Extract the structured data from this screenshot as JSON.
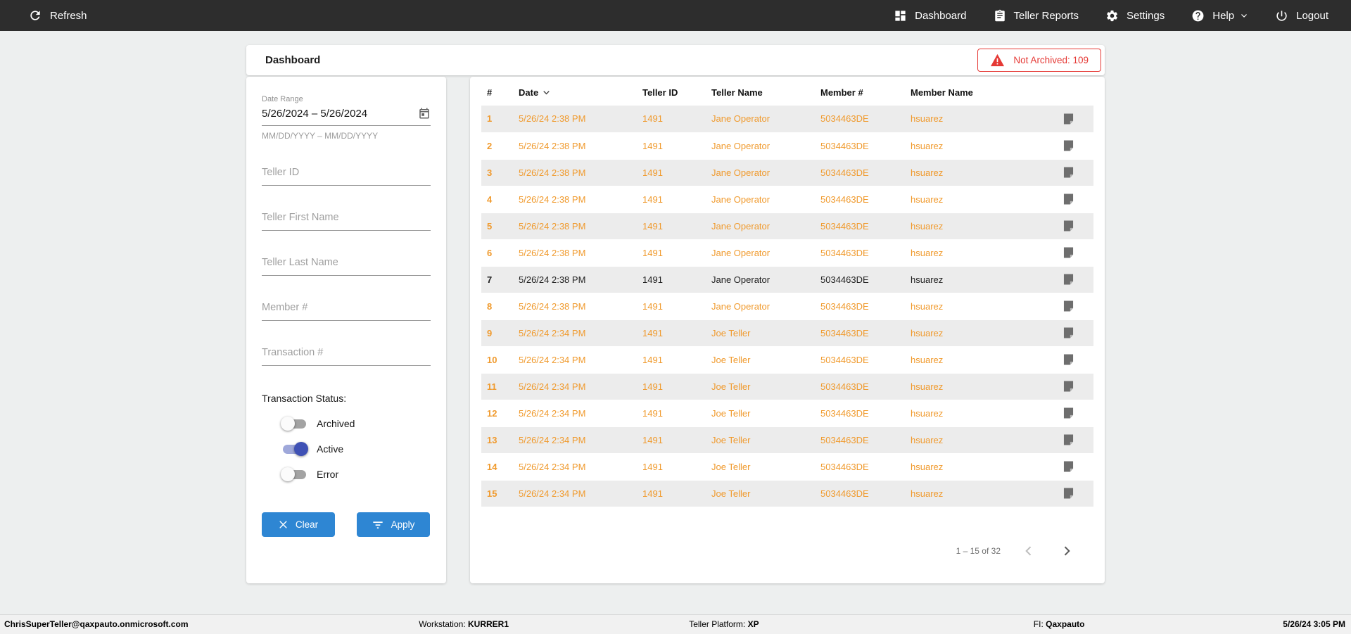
{
  "colors": {
    "topbar_bg": "#2d2d2d",
    "accent": "#2e86d3",
    "orange": "#f09a2d",
    "red": "#e53935",
    "toggle_on": "#3f51b5",
    "toggle_on_track": "#9fa8da",
    "row_stripe": "#ececec"
  },
  "topbar": {
    "refresh_label": "Refresh",
    "items": [
      {
        "id": "dashboard",
        "label": "Dashboard",
        "icon": "dashboard-icon",
        "chevron": false
      },
      {
        "id": "teller-reports",
        "label": "Teller Reports",
        "icon": "clipboard-icon",
        "chevron": false
      },
      {
        "id": "settings",
        "label": "Settings",
        "icon": "gear-icon",
        "chevron": false
      },
      {
        "id": "help",
        "label": "Help",
        "icon": "help-icon",
        "chevron": true
      },
      {
        "id": "logout",
        "label": "Logout",
        "icon": "power-icon",
        "chevron": false
      }
    ]
  },
  "header": {
    "title": "Dashboard",
    "not_archived_label": "Not Archived: 109"
  },
  "filters": {
    "date_range": {
      "label": "Date Range",
      "value": "5/26/2024 – 5/26/2024",
      "hint": "MM/DD/YYYY – MM/DD/YYYY"
    },
    "fields": [
      {
        "id": "teller-id",
        "placeholder": "Teller ID"
      },
      {
        "id": "teller-first-name",
        "placeholder": "Teller First Name"
      },
      {
        "id": "teller-last-name",
        "placeholder": "Teller Last Name"
      },
      {
        "id": "member-number",
        "placeholder": "Member #"
      },
      {
        "id": "transaction-number",
        "placeholder": "Transaction #"
      }
    ],
    "status": {
      "label": "Transaction Status:",
      "toggles": [
        {
          "id": "archived",
          "label": "Archived",
          "on": false
        },
        {
          "id": "active",
          "label": "Active",
          "on": true
        },
        {
          "id": "error",
          "label": "Error",
          "on": false
        }
      ]
    },
    "clear_label": "Clear",
    "apply_label": "Apply"
  },
  "table": {
    "columns": [
      "#",
      "Date",
      "Teller ID",
      "Teller Name",
      "Member #",
      "Member Name",
      ""
    ],
    "sorted_column": "Date",
    "rows": [
      {
        "num": "1",
        "date": "5/26/24 2:38 PM",
        "teller_id": "1491",
        "teller_name": "Jane Operator",
        "member_number": "5034463DE",
        "member_name": "hsuarez",
        "dark": false
      },
      {
        "num": "2",
        "date": "5/26/24 2:38 PM",
        "teller_id": "1491",
        "teller_name": "Jane Operator",
        "member_number": "5034463DE",
        "member_name": "hsuarez",
        "dark": false
      },
      {
        "num": "3",
        "date": "5/26/24 2:38 PM",
        "teller_id": "1491",
        "teller_name": "Jane Operator",
        "member_number": "5034463DE",
        "member_name": "hsuarez",
        "dark": false
      },
      {
        "num": "4",
        "date": "5/26/24 2:38 PM",
        "teller_id": "1491",
        "teller_name": "Jane Operator",
        "member_number": "5034463DE",
        "member_name": "hsuarez",
        "dark": false
      },
      {
        "num": "5",
        "date": "5/26/24 2:38 PM",
        "teller_id": "1491",
        "teller_name": "Jane Operator",
        "member_number": "5034463DE",
        "member_name": "hsuarez",
        "dark": false
      },
      {
        "num": "6",
        "date": "5/26/24 2:38 PM",
        "teller_id": "1491",
        "teller_name": "Jane Operator",
        "member_number": "5034463DE",
        "member_name": "hsuarez",
        "dark": false
      },
      {
        "num": "7",
        "date": "5/26/24 2:38 PM",
        "teller_id": "1491",
        "teller_name": "Jane Operator",
        "member_number": "5034463DE",
        "member_name": "hsuarez",
        "dark": true
      },
      {
        "num": "8",
        "date": "5/26/24 2:38 PM",
        "teller_id": "1491",
        "teller_name": "Jane Operator",
        "member_number": "5034463DE",
        "member_name": "hsuarez",
        "dark": false
      },
      {
        "num": "9",
        "date": "5/26/24 2:34 PM",
        "teller_id": "1491",
        "teller_name": "Joe Teller",
        "member_number": "5034463DE",
        "member_name": "hsuarez",
        "dark": false
      },
      {
        "num": "10",
        "date": "5/26/24 2:34 PM",
        "teller_id": "1491",
        "teller_name": "Joe Teller",
        "member_number": "5034463DE",
        "member_name": "hsuarez",
        "dark": false
      },
      {
        "num": "11",
        "date": "5/26/24 2:34 PM",
        "teller_id": "1491",
        "teller_name": "Joe Teller",
        "member_number": "5034463DE",
        "member_name": "hsuarez",
        "dark": false
      },
      {
        "num": "12",
        "date": "5/26/24 2:34 PM",
        "teller_id": "1491",
        "teller_name": "Joe Teller",
        "member_number": "5034463DE",
        "member_name": "hsuarez",
        "dark": false
      },
      {
        "num": "13",
        "date": "5/26/24 2:34 PM",
        "teller_id": "1491",
        "teller_name": "Joe Teller",
        "member_number": "5034463DE",
        "member_name": "hsuarez",
        "dark": false
      },
      {
        "num": "14",
        "date": "5/26/24 2:34 PM",
        "teller_id": "1491",
        "teller_name": "Joe Teller",
        "member_number": "5034463DE",
        "member_name": "hsuarez",
        "dark": false
      },
      {
        "num": "15",
        "date": "5/26/24 2:34 PM",
        "teller_id": "1491",
        "teller_name": "Joe Teller",
        "member_number": "5034463DE",
        "member_name": "hsuarez",
        "dark": false
      }
    ],
    "row_icon": "note-icon",
    "pagination": {
      "range_label": "1 – 15 of 32"
    }
  },
  "footer": {
    "user": "ChrisSuperTeller@qaxpauto.onmicrosoft.com",
    "workstation_label": "Workstation:",
    "workstation_value": "KURRER1",
    "platform_label": "Teller Platform:",
    "platform_value": "XP",
    "fi_label": "FI:",
    "fi_value": "Qaxpauto",
    "datetime": "5/26/24 3:05 PM"
  }
}
